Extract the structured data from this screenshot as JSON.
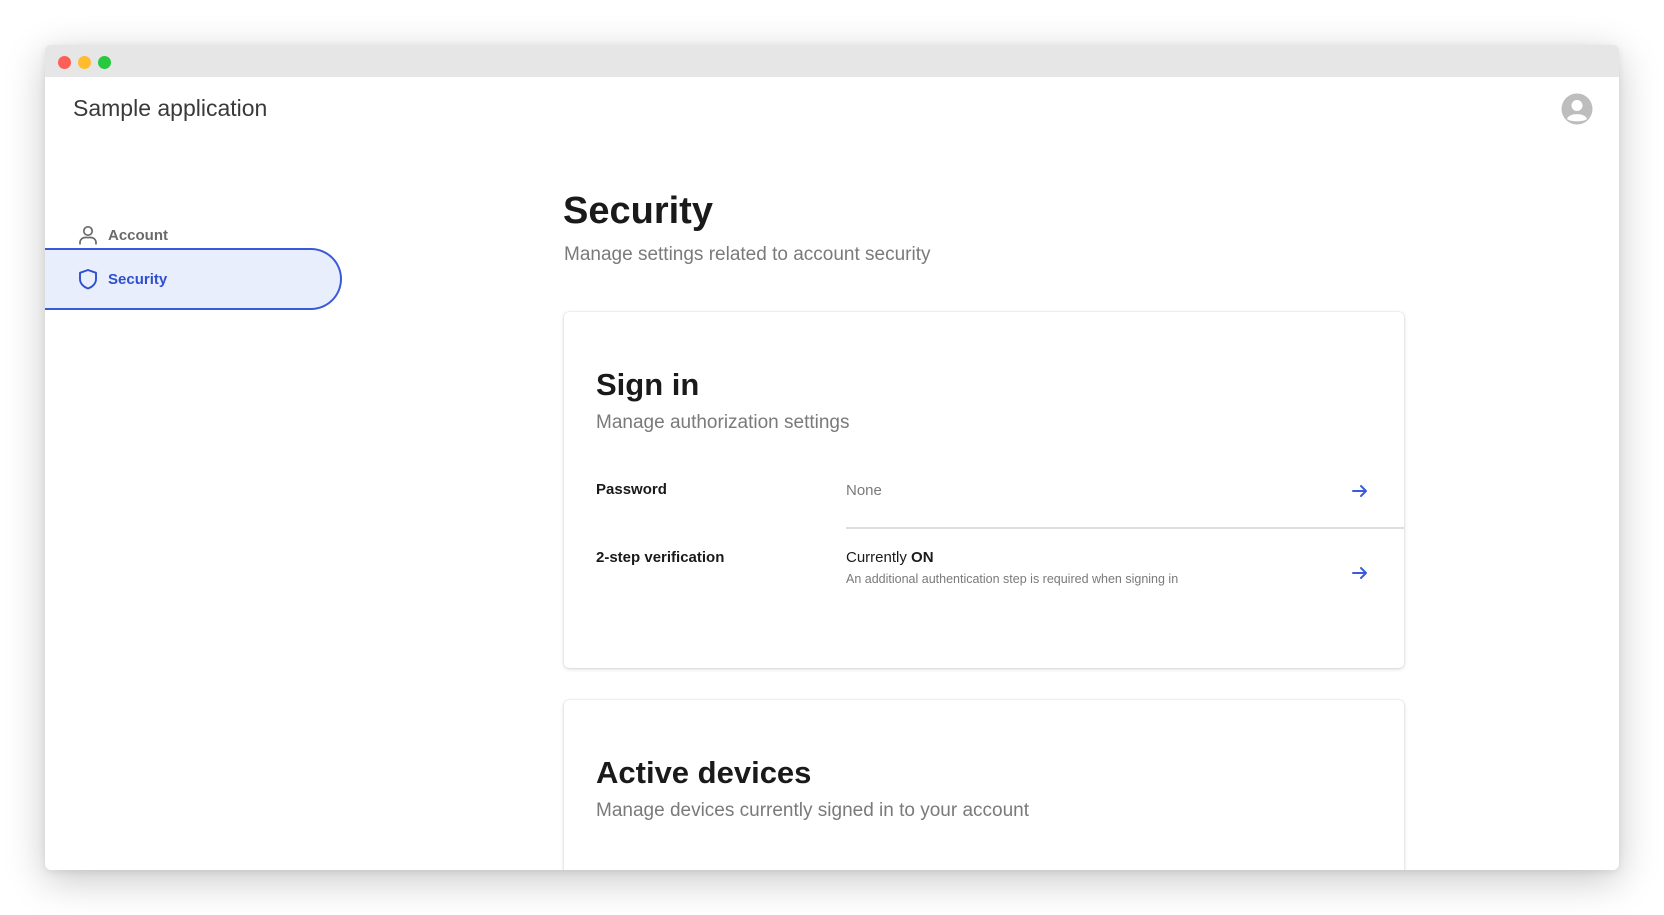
{
  "window": {
    "controls": [
      "close",
      "minimize",
      "maximize"
    ]
  },
  "header": {
    "app_title": "Sample application",
    "avatar_icon": "user-avatar-icon"
  },
  "sidebar": {
    "items": [
      {
        "label": "Account",
        "icon": "person-icon",
        "active": false
      },
      {
        "label": "Security",
        "icon": "shield-icon",
        "active": true
      }
    ]
  },
  "page": {
    "title": "Security",
    "subtitle": "Manage settings related to account security"
  },
  "sign_in": {
    "title": "Sign in",
    "subtitle": "Manage authorization settings",
    "rows": [
      {
        "label": "Password",
        "value": "None",
        "icon": "arrow-right-icon"
      },
      {
        "label": "2-step verification",
        "value_prefix": "Currently ",
        "value_status": "ON",
        "description": "An additional authentication step is required when signing in",
        "icon": "arrow-right-icon"
      }
    ]
  },
  "active_devices": {
    "title": "Active devices",
    "subtitle": "Manage devices currently signed in to your account"
  },
  "colors": {
    "accent": "#3a5bd9",
    "active_bg": "#e9eefc",
    "titlebar": "#e6e6e6",
    "text_primary": "#1a1a1a",
    "text_secondary": "#7a7a7a"
  }
}
